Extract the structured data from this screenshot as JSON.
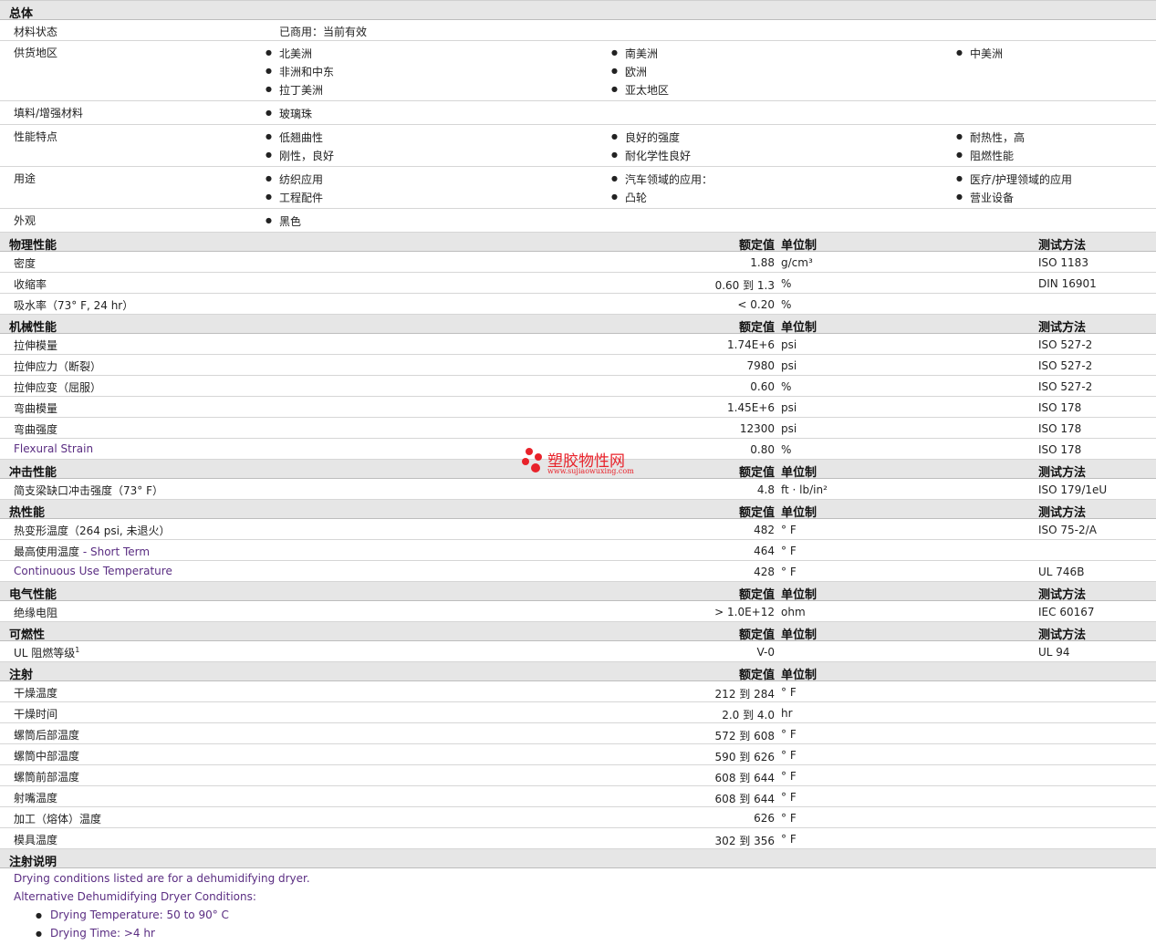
{
  "general": {
    "title": "总体",
    "material_status_label": "材料状态",
    "material_status_value": "已商用：当前有效",
    "regions_label": "供货地区",
    "regions": [
      "北美洲",
      "南美洲",
      "中美洲",
      "非洲和中东",
      "欧洲",
      "拉丁美洲",
      "亚太地区"
    ],
    "filler_label": "填料/增强材料",
    "filler": "玻璃珠",
    "features_label": "性能特点",
    "features": [
      "低翘曲性",
      "良好的强度",
      "耐热性，高",
      "刚性，良好",
      "耐化学性良好",
      "阻燃性能"
    ],
    "uses_label": "用途",
    "uses": [
      "纺织应用",
      "汽车领域的应用：",
      "医疗/护理领域的应用",
      "工程配件",
      "凸轮",
      "营业设备"
    ],
    "appearance_label": "外观",
    "appearance": "黑色"
  },
  "headers": {
    "nominal": "额定值",
    "unit": "单位制",
    "test": "测试方法"
  },
  "physical": {
    "title": "物理性能",
    "rows": [
      {
        "label": "密度",
        "value": "1.88",
        "unit": "g/cm³",
        "test": "ISO 1183"
      },
      {
        "label": "收缩率",
        "value": "0.60 到  1.3",
        "unit": "%",
        "test": "DIN 16901"
      },
      {
        "label": "吸水率（73°  F, 24 hr）",
        "value": "< 0.20",
        "unit": "%",
        "test": ""
      }
    ]
  },
  "mechanical": {
    "title": "机械性能",
    "rows": [
      {
        "label": "拉伸模量",
        "value": "1.74E+6",
        "unit": "psi",
        "test": "ISO 527-2"
      },
      {
        "label": "拉伸应力（断裂）",
        "value": "7980",
        "unit": "psi",
        "test": "ISO 527-2"
      },
      {
        "label": "拉伸应变（屈服）",
        "value": "0.60",
        "unit": "%",
        "test": "ISO 527-2"
      },
      {
        "label": "弯曲模量",
        "value": "1.45E+6",
        "unit": "psi",
        "test": "ISO 178"
      },
      {
        "label": "弯曲强度",
        "value": "12300",
        "unit": "psi",
        "test": "ISO 178"
      },
      {
        "label": "Flexural Strain",
        "value": "0.80",
        "unit": "%",
        "test": "ISO 178",
        "en": true
      }
    ]
  },
  "impact": {
    "title": "冲击性能",
    "rows": [
      {
        "label": "简支梁缺口冲击强度（73°  F）",
        "value": "4.8",
        "unit": "ft · lb/in²",
        "test": "ISO 179/1eU"
      }
    ]
  },
  "thermal": {
    "title": "热性能",
    "rows": [
      {
        "label": "热变形温度（264 psi, 未退火）",
        "value": "482",
        "unit": "°  F",
        "test": "ISO 75-2/A"
      },
      {
        "label": "最高使用温度",
        "sub": " - Short Term",
        "value": "464",
        "unit": "°  F",
        "test": ""
      },
      {
        "label": "Continuous Use Temperature",
        "value": "428",
        "unit": "°  F",
        "test": "UL 746B",
        "en": true
      }
    ]
  },
  "electrical": {
    "title": "电气性能",
    "rows": [
      {
        "label": "绝缘电阻",
        "value": "> 1.0E+12",
        "unit": "ohm",
        "test": "IEC 60167"
      }
    ]
  },
  "flammability": {
    "title": "可燃性",
    "rows": [
      {
        "label": "UL 阻燃等级",
        "sup": "1",
        "value": "V-0",
        "unit": "",
        "test": "UL 94"
      }
    ]
  },
  "injection": {
    "title": "注射",
    "rows": [
      {
        "label": "干燥温度",
        "value": "212 到  284",
        "unit": "°  F",
        "test": ""
      },
      {
        "label": "干燥时间",
        "value": "2.0 到  4.0",
        "unit": "hr",
        "test": ""
      },
      {
        "label": "螺筒后部温度",
        "value": "572 到  608",
        "unit": "°  F",
        "test": ""
      },
      {
        "label": "螺筒中部温度",
        "value": "590 到  626",
        "unit": "°  F",
        "test": ""
      },
      {
        "label": "螺筒前部温度",
        "value": "608 到  644",
        "unit": "°  F",
        "test": ""
      },
      {
        "label": "射嘴温度",
        "value": "608 到  644",
        "unit": "°  F",
        "test": ""
      },
      {
        "label": "加工（熔体）温度",
        "value": "626",
        "unit": "°  F",
        "test": ""
      },
      {
        "label": "模具温度",
        "value": "302 到  356",
        "unit": "°  F",
        "test": ""
      }
    ]
  },
  "notes": {
    "title": "注射说明",
    "line1": "Drying conditions listed are for a dehumidifying dryer.",
    "line2": "Alternative Dehumidifying Dryer Conditions:",
    "bullets": [
      "Drying Temperature: 50 to 90°  C",
      "Drying Time: >4 hr"
    ]
  },
  "watermark": {
    "cn": "塑胶物性网",
    "url": "www.sujiaowuxing.com"
  }
}
